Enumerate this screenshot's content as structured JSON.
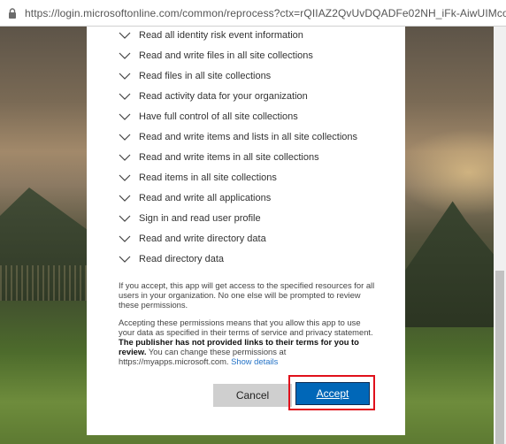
{
  "browser": {
    "url": "https://login.microsoftonline.com/common/reprocess?ctx=rQIIAZ2QvUvDQADFe02NH_iFk-AiwUIMcolp..."
  },
  "permissions": [
    "Read all identity risk event information",
    "Read and write files in all site collections",
    "Read files in all site collections",
    "Read activity data for your organization",
    "Have full control of all site collections",
    "Read and write items and lists in all site collections",
    "Read and write items in all site collections",
    "Read items in all site collections",
    "Read and write all applications",
    "Sign in and read user profile",
    "Read and write directory data",
    "Read directory data"
  ],
  "consent": {
    "paragraph1": "If you accept, this app will get access to the specified resources for all users in your organization. No one else will be prompted to review these permissions.",
    "paragraph2_start": "Accepting these permissions means that you allow this app to use your data as specified in their terms of service and privacy statement. ",
    "paragraph2_bold": "The publisher has not provided links to their terms for you to review.",
    "paragraph2_end": " You can change these permissions at https://myapps.microsoft.com. ",
    "show_details": "Show details"
  },
  "buttons": {
    "cancel": "Cancel",
    "accept": "Accept"
  },
  "colors": {
    "accept_bg": "#0067b8",
    "highlight_border": "#e0101b",
    "link": "#2372c6"
  },
  "icons": {
    "address_bar": "lock-icon",
    "permission_item": "chevron-down-icon"
  }
}
